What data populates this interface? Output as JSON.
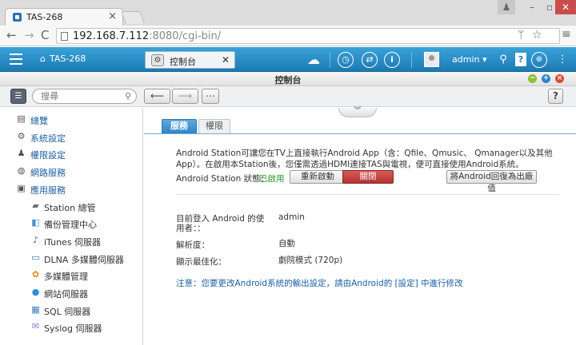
{
  "browser": {
    "tab_title": "TAS-268",
    "url_host": "192.168.7.112",
    "url_path": ":8080/cgi-bin/"
  },
  "topbar": {
    "device_name": "TAS-268",
    "app_tab_label": "控制台",
    "username": "admin ▾"
  },
  "window": {
    "title": "控制台"
  },
  "toolbar": {
    "search_placeholder": "搜尋"
  },
  "sidebar": {
    "items": [
      {
        "label": "總覽",
        "icon": "overview-icon",
        "level": "top"
      },
      {
        "label": "系統設定",
        "icon": "gear-icon",
        "level": "top"
      },
      {
        "label": "權限設定",
        "icon": "user-icon",
        "level": "top"
      },
      {
        "label": "網路服務",
        "icon": "network-icon",
        "level": "top"
      },
      {
        "label": "應用服務",
        "icon": "app-service-icon",
        "level": "top"
      },
      {
        "label": "Station 總管",
        "icon": "station-icon",
        "level": "sub"
      },
      {
        "label": "備份管理中心",
        "icon": "backup-icon",
        "level": "sub"
      },
      {
        "label": "iTunes 伺服器",
        "icon": "itunes-icon",
        "level": "sub"
      },
      {
        "label": "DLNA 多媒體伺服器",
        "icon": "dlna-icon",
        "level": "sub"
      },
      {
        "label": "多媒體管理",
        "icon": "multimedia-icon",
        "level": "sub"
      },
      {
        "label": "網站伺服器",
        "icon": "web-server-icon",
        "level": "sub"
      },
      {
        "label": "SQL 伺服器",
        "icon": "sql-icon",
        "level": "sub"
      },
      {
        "label": "Syslog 伺服器",
        "icon": "syslog-icon",
        "level": "sub"
      }
    ]
  },
  "panel": {
    "tabs": [
      "服務",
      "權限"
    ],
    "description": "Android Station可讓您在TV上直接執行Android App（含：Qfile、Qmusic、 Qmanager以及其他App）。在啟用本Station後，您僅需透過HDMI連接TAS與電視，便可直接使用Android系統。",
    "status_label": "Android Station 狀態：",
    "status_value": "已啟用",
    "restart_button": "重新啟動",
    "close_button": "關閉",
    "reset_button": "將Android回復為出廠值",
    "current_user_label": "目前登入 Android 的使用者：：",
    "current_user_value": "admin",
    "resolution_label": "解析度：",
    "resolution_value": "自動",
    "display_label": "顯示最佳化：",
    "display_value": "劇院模式 (720p)",
    "note": "注意：您要更改Android系統的輸出設定，請由Android的 [設定] 中進行修改"
  },
  "colors": {
    "topbar_blue": "#2a8ec9",
    "status_green": "#2a9a2a",
    "close_red": "#c24444",
    "link_blue": "#1b5ea0"
  }
}
